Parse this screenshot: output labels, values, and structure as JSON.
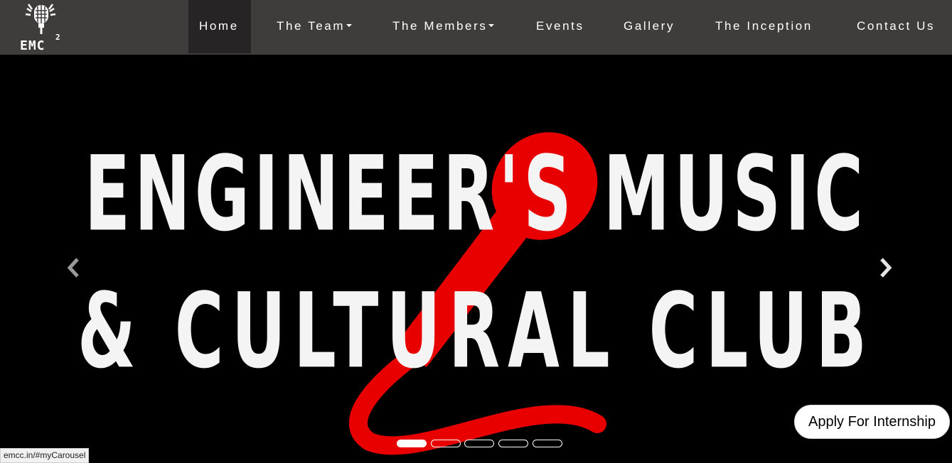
{
  "brand": {
    "logo_text": "EMC",
    "logo_sup": "2"
  },
  "nav": {
    "items": [
      {
        "label": "Home",
        "active": true,
        "dropdown": false
      },
      {
        "label": "The Team",
        "active": false,
        "dropdown": true
      },
      {
        "label": "The Members",
        "active": false,
        "dropdown": true
      },
      {
        "label": "Events",
        "active": false,
        "dropdown": false
      },
      {
        "label": "Gallery",
        "active": false,
        "dropdown": false
      },
      {
        "label": "The Inception",
        "active": false,
        "dropdown": false
      },
      {
        "label": "Contact Us",
        "active": false,
        "dropdown": false
      }
    ]
  },
  "carousel": {
    "headline_line1": "ENGINEER'S MUSIC",
    "headline_line2": "& CULTURAL CLUB",
    "slide_count": 5,
    "active_slide": 1,
    "prev_icon": "chevron-left-icon",
    "next_icon": "chevron-right-icon"
  },
  "apply": {
    "label": "Apply For Internship"
  },
  "status": {
    "url": "emcc.in/#myCarousel"
  },
  "colors": {
    "navbar_bg": "#3f3c3c",
    "nav_active_bg": "#262424",
    "mic_red": "#e80000",
    "headline": "#f4f4f4"
  }
}
